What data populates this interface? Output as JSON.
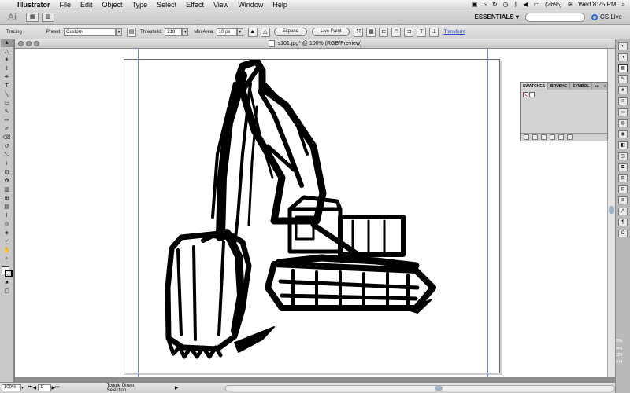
{
  "menubar": {
    "app_name": "Illustrator",
    "items": [
      "File",
      "Edit",
      "Object",
      "Type",
      "Select",
      "Effect",
      "View",
      "Window",
      "Help"
    ],
    "status": {
      "badge_count": "5",
      "battery": "(26%)",
      "clock": "Wed 8:25 PM"
    }
  },
  "appbar": {
    "logo": "Ai",
    "workspace": "ESSENTIALS",
    "cs_live": "CS Live"
  },
  "controlbar": {
    "mode_label": "Tracing",
    "preset_label": "Preset:",
    "preset_value": "Custom",
    "threshold_label": "Threshold:",
    "threshold_value": "218",
    "min_area_label": "Min Area:",
    "min_area_value": "10 px",
    "expand_label": "Expand",
    "live_paint_label": "Live Paint",
    "transform_link": "Transform"
  },
  "document": {
    "tab_title": "s101.jpg* @ 100% (RGB/Preview)"
  },
  "statusbar": {
    "zoom": "100%",
    "page": "1",
    "status_text": "Toggle Direct Selection"
  },
  "swatches_panel": {
    "tabs": [
      "SWATCHES",
      "BRUSHE",
      "SYMBOL"
    ],
    "colors": [
      "#ffffff",
      "#000000",
      "#ff0000"
    ]
  },
  "desktop_sliver": [
    "29b",
    "ang",
    "119",
    "074"
  ],
  "icons": {
    "tools": [
      "selection-icon",
      "direct-selection-icon",
      "magic-wand-icon",
      "lasso-icon",
      "pen-icon",
      "type-icon",
      "line-icon",
      "rectangle-icon",
      "paintbrush-icon",
      "pencil-icon",
      "blob-brush-icon",
      "eraser-icon",
      "rotate-icon",
      "scale-icon",
      "warp-icon",
      "free-transform-icon",
      "symbol-sprayer-icon",
      "graph-icon",
      "mesh-icon",
      "gradient-icon",
      "eyedropper-icon",
      "blend-icon",
      "live-paint-icon",
      "slice-icon",
      "hand-icon",
      "zoom-icon"
    ]
  }
}
